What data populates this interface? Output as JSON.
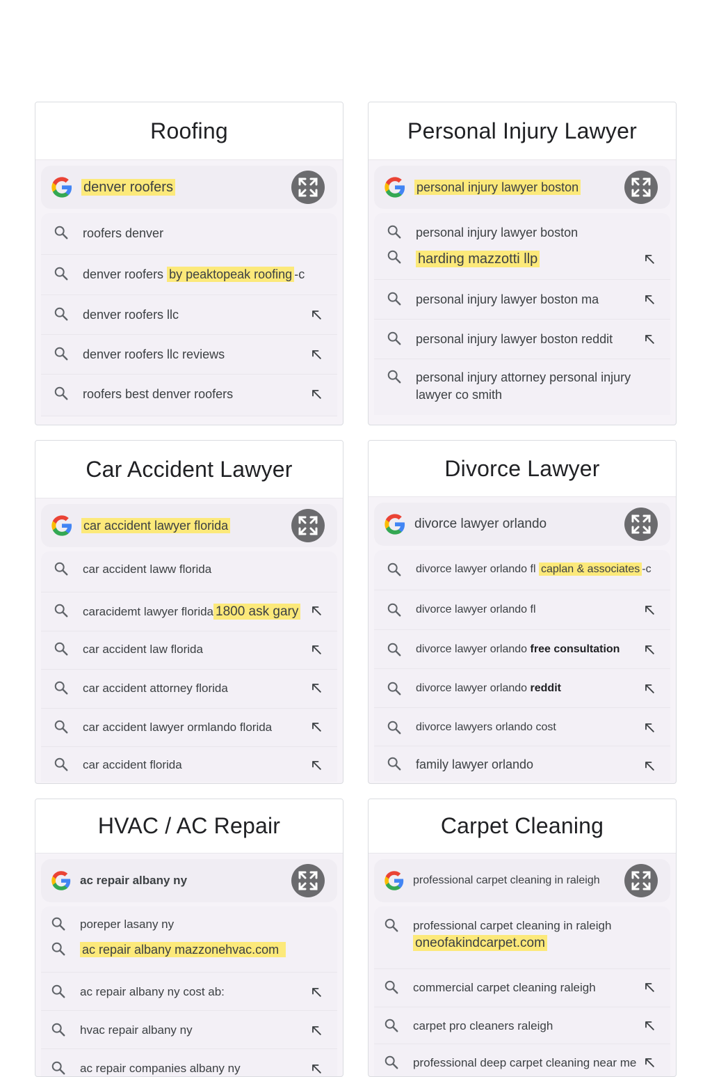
{
  "cards": [
    {
      "title": "Roofing",
      "query_plain": "",
      "query_hl": "denver roofers",
      "suggestions": [
        {
          "text": "roofers denver"
        },
        {
          "text": "denver roofers ",
          "hl": "by peaktopeak roofing",
          "tail": "-c"
        },
        {
          "text": "denver roofers llc"
        },
        {
          "text": "denver roofers llc reviews"
        },
        {
          "text": "roofers best denver roofers"
        }
      ]
    },
    {
      "title": "Personal Injury Lawyer",
      "query_plain": "",
      "query_hl": "personal injury lawyer boston",
      "suggestions": [
        {
          "text": "personal injury lawyer boston"
        },
        {
          "hl": "harding mazzotti llp"
        },
        {
          "text": "personal injury lawyer boston ma"
        },
        {
          "text": "personal injury lawyer boston reddit"
        },
        {
          "text": "personal injury attorney personal injury lawyer co smith"
        }
      ]
    },
    {
      "title": "Car Accident Lawyer",
      "query_plain": "",
      "query_hl": "car accident lawyer florida",
      "suggestions": [
        {
          "text": "car accident laww florida"
        },
        {
          "text": "caracidemt lawyer florida",
          "hl": "1800 ask gary"
        },
        {
          "text": "car accident law florida"
        },
        {
          "text": "car accident attorney florida"
        },
        {
          "text": "car accident lawyer ormlando florida"
        },
        {
          "text": "car accident florida"
        }
      ]
    },
    {
      "title": "Divorce Lawyer",
      "query_plain": "divorce lawyer orlando",
      "query_hl": "",
      "suggestions": [
        {
          "text": "divorce lawyer orlando fl ",
          "hl": "caplan & associates",
          "tail": "-c"
        },
        {
          "text": "divorce lawyer orlando fl"
        },
        {
          "text": "divorce lawyer orlando ",
          "bold": "free consultation"
        },
        {
          "text": "divorce lawyer orlando ",
          "bold": "reddit"
        },
        {
          "text": "divorce lawyers orlando cost"
        },
        {
          "text": "family lawyer orlando"
        }
      ]
    },
    {
      "title": "HVAC / AC Repair",
      "query_plain": "ac repair albany ny",
      "query_hl": "",
      "suggestions": [
        {
          "text": "poreper lasany ny"
        },
        {
          "hl": "ac repair albany mazzonehvac.com"
        },
        {
          "text": "ac repair albany ny cost",
          "tail": " ab:"
        },
        {
          "text": "hvac repair albany ny"
        },
        {
          "text": "ac repair companies albany ny"
        }
      ]
    },
    {
      "title": "Carpet Cleaning",
      "query_plain": "professional carpet cleaning in raleigh",
      "query_hl": "",
      "suggestions": [
        {
          "text": "professional carpet cleaning in raleigh",
          "hl2": "oneofakindcarpet.com"
        },
        {
          "text": "commercial carpet cleaning raleigh"
        },
        {
          "text": "carpet pro cleaners raleigh"
        },
        {
          "text": "professional deep carpet cleaning near me"
        }
      ]
    }
  ],
  "icons": {
    "logo": "google-g-icon",
    "expand": "expand-icon",
    "search": "search-icon",
    "fill": "arrow-up-left-icon"
  },
  "colors": {
    "highlight": "#fce97a",
    "expand_button": "#6b6b6e",
    "card_bg": "#f6f3f8"
  }
}
